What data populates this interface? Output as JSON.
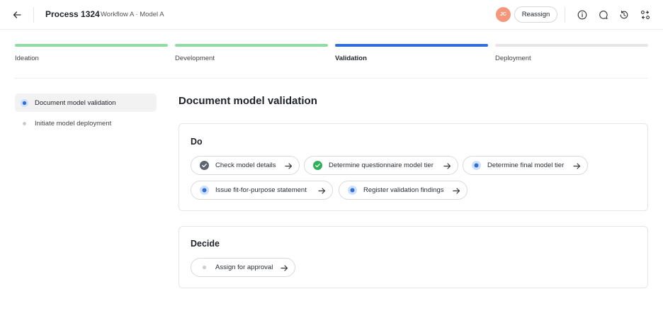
{
  "header": {
    "title": "Process 1324",
    "breadcrumb": "Workflow A · Model A",
    "avatar_initials": "JC",
    "reassign_label": "Reassign",
    "icons": [
      "back-arrow-icon",
      "info-icon",
      "comment-icon",
      "history-icon",
      "workflow-icon"
    ]
  },
  "stepper": [
    {
      "label": "Ideation",
      "state": "done",
      "color": "#8fdda3"
    },
    {
      "label": "Development",
      "state": "done",
      "color": "#8fdda3"
    },
    {
      "label": "Validation",
      "state": "active",
      "color": "#2f6fd8"
    },
    {
      "label": "Deployment",
      "state": "upcoming",
      "color": "#e6e6e6"
    }
  ],
  "sidebar": {
    "items": [
      {
        "label": "Document model validation",
        "active": true
      },
      {
        "label": "Initiate model deployment",
        "active": false
      }
    ]
  },
  "main": {
    "title": "Document model validation",
    "sections": [
      {
        "title": "Do",
        "tasks": [
          {
            "label": "Check model details",
            "status": "completed-gray"
          },
          {
            "label": "Determine questionnaire model tier",
            "status": "completed-green"
          },
          {
            "label": "Determine final model tier",
            "status": "in-progress"
          },
          {
            "label": "Issue fit-for-purpose statement",
            "status": "in-progress"
          },
          {
            "label": "Register validation findings",
            "status": "in-progress"
          }
        ]
      },
      {
        "title": "Decide",
        "tasks": [
          {
            "label": "Assign for approval",
            "status": "not-started"
          }
        ]
      }
    ]
  },
  "colors": {
    "accent_blue": "#2f6fd8",
    "done_green": "#8fdda3",
    "check_green": "#2fb15a",
    "check_gray": "#5f6670",
    "avatar": "#f5977b"
  }
}
